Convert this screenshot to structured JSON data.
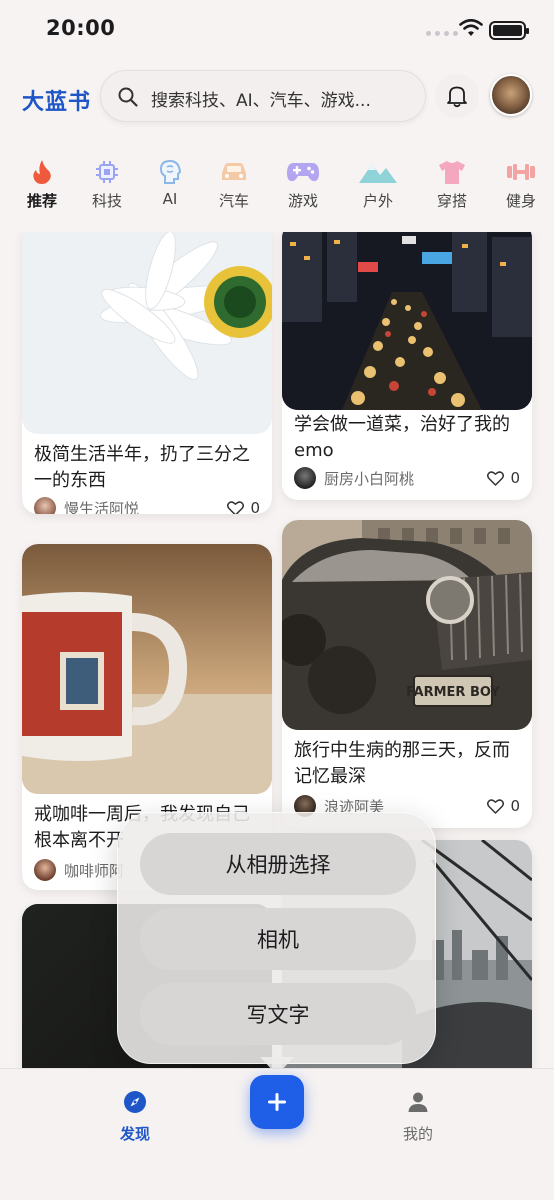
{
  "status": {
    "time": "20:00"
  },
  "header": {
    "logo": "大蓝书",
    "search_placeholder": "搜索科技、AI、汽车、游戏..."
  },
  "categories": [
    {
      "label": "推荐",
      "icon": "flame-icon",
      "active": true
    },
    {
      "label": "科技",
      "icon": "chip-icon"
    },
    {
      "label": "AI",
      "icon": "brain-icon"
    },
    {
      "label": "汽车",
      "icon": "car-icon"
    },
    {
      "label": "游戏",
      "icon": "gamepad-icon"
    },
    {
      "label": "户外",
      "icon": "mountain-icon"
    },
    {
      "label": "穿搭",
      "icon": "tshirt-icon"
    },
    {
      "label": "健身",
      "icon": "dumbbell-icon"
    }
  ],
  "feed": {
    "cards": [
      {
        "title": "极简生活半年，扔了三分之一的东西",
        "author": "慢生活阿悦",
        "likes": "0",
        "image": "daisy-photo"
      },
      {
        "title": "学会做一道菜，治好了我的emo",
        "author": "厨房小白阿桃",
        "likes": "0",
        "image": "city-night-traffic-photo"
      },
      {
        "title": "戒咖啡一周后，我发现自己根本离不开",
        "author": "咖啡师阿",
        "likes": "0",
        "image": "coffee-mug-photo"
      },
      {
        "title": "旅行中生病的那三天，反而记忆最深",
        "author": "浪迹阿美",
        "likes": "0",
        "image": "vintage-car-photo"
      }
    ]
  },
  "popup": {
    "options": [
      "从相册选择",
      "相机",
      "写文字"
    ]
  },
  "tabbar": {
    "discover": "发现",
    "mine": "我的"
  },
  "colors": {
    "accent": "#1e56c8",
    "fab": "#1f5fe8"
  }
}
